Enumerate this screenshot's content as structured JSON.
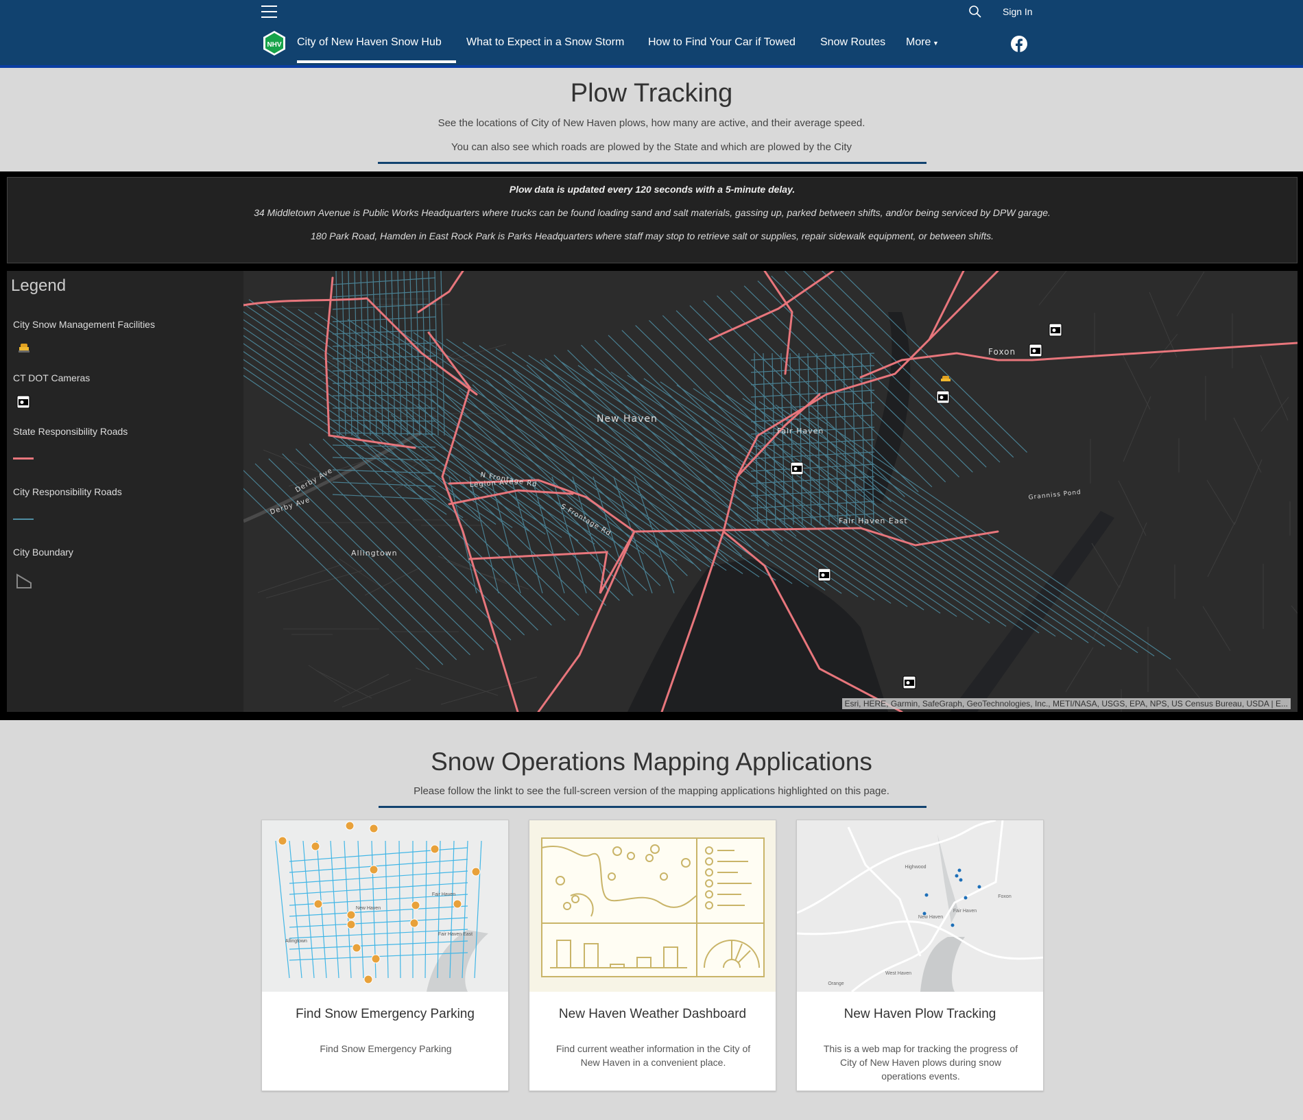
{
  "header": {
    "sign_in": "Sign In",
    "nav": [
      {
        "label": "City of New Haven Snow Hub",
        "active": true
      },
      {
        "label": "What to Expect in a Snow Storm"
      },
      {
        "label": "How to Find Your Car if Towed"
      },
      {
        "label": "Snow Routes"
      },
      {
        "label": "More"
      }
    ],
    "logo_text": "NHV",
    "icons": [
      "menu-icon",
      "search-icon",
      "facebook-icon",
      "caret-down-icon"
    ]
  },
  "intro": {
    "title": "Plow Tracking",
    "line1": "See the locations of City of New Haven plows, how many are active, and their average speed.",
    "line2": "You can also see which roads are plowed by the State and which are plowed by the City"
  },
  "notice": {
    "line1": "Plow data is updated every 120 seconds with a 5-minute delay.",
    "line2": "34 Middletown Avenue is Public Works Headquarters where trucks can be found loading sand and salt materials, gassing up, parked between shifts, and/or being serviced by DPW garage.",
    "line3": "180 Park Road, Hamden in East Rock Park is Parks Headquarters where staff may stop to retrieve salt or supplies, repair sidewalk equipment, or between shifts."
  },
  "legend": {
    "title": "Legend",
    "items": [
      {
        "label": "City Snow Management Facilities",
        "symbol": "snowplow-icon"
      },
      {
        "label": "CT DOT Cameras",
        "symbol": "camera-icon"
      },
      {
        "label": "State Responsibility Roads",
        "symbol": "line",
        "color": "#e8767c"
      },
      {
        "label": "City Responsibility Roads",
        "symbol": "line",
        "color": "#4f8ea3"
      },
      {
        "label": "City Boundary",
        "symbol": "polygon-outline"
      }
    ]
  },
  "map": {
    "labels": [
      "New Haven",
      "Fair Haven",
      "Fair Haven East",
      "Foxon",
      "Allingtown",
      "Derby Ave",
      "Derby Ave",
      "Legion Ave",
      "N Frontage Rd",
      "S Frontage Rd",
      "Granniss Pond"
    ],
    "attribution": "Esri, HERE, Garmin, SafeGraph, GeoTechnologies, Inc., METI/NASA, USGS, EPA, NPS, US Census Bureau, USDA | E...",
    "colors": {
      "state_roads": "#e8767c",
      "city_roads": "#4f8ea3",
      "background": "#2c2c2c"
    }
  },
  "apps": {
    "title": "Snow Operations Mapping Applications",
    "subtitle": "Please follow the linkt to see the full-screen version of the mapping applications highlighted on this page.",
    "cards": [
      {
        "title": "Find Snow Emergency Parking",
        "description": "Find Snow Emergency Parking",
        "thumb_labels": [
          "New Haven",
          "Fair Haven",
          "Fair Haven East",
          "Allingtown"
        ]
      },
      {
        "title": "New Haven Weather Dashboard",
        "description": "Find current weather information in the City of New Haven in a convenient place."
      },
      {
        "title": "New Haven Plow Tracking",
        "description": "This is a web map for tracking the progress of City of New Haven plows during snow operations events.",
        "thumb_labels": [
          "Highwood",
          "New Haven",
          "Fair Haven",
          "Foxon",
          "West Haven",
          "Orange"
        ]
      }
    ]
  },
  "colors": {
    "header": "#11426f",
    "accent": "#0b3ea3",
    "page": "#d9d9d9"
  }
}
